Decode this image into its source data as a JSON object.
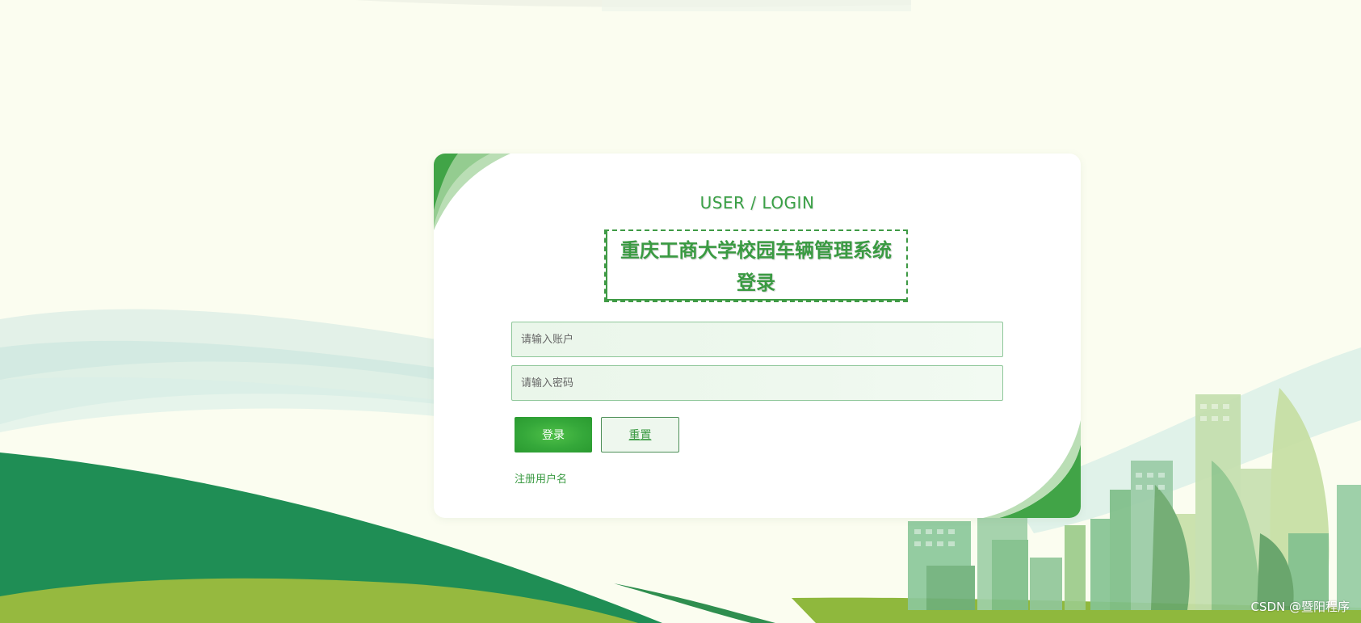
{
  "login": {
    "subtitle": "USER / LOGIN",
    "system_title": "重庆工商大学校园车辆管理系统",
    "system_title_suffix": "登录",
    "username_placeholder": "请输入账户",
    "password_placeholder": "请输入密码",
    "login_button": "登录",
    "reset_button": "重置",
    "register_link": "注册用户名"
  },
  "watermark": "CSDN @暨阳程序",
  "colors": {
    "accent_green": "#3aa046",
    "dark_green": "#1f8e55",
    "olive_green": "#8fb83d",
    "background": "#fbfdf0"
  }
}
